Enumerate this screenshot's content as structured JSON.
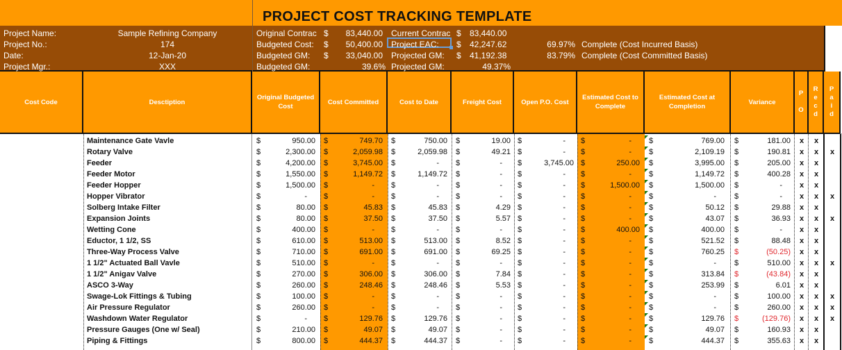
{
  "title": "PROJECT COST TRACKING TEMPLATE",
  "project_info": {
    "labels": [
      "Project Name:",
      "Project No.:",
      "Date:",
      "Project Mgr.:"
    ],
    "values": [
      "Sample Refining Company",
      "174",
      "12-Jan-20",
      "XXX"
    ]
  },
  "summary_left": [
    {
      "label": "Original Contrac",
      "currency": "$",
      "value": "83,440.00"
    },
    {
      "label": "Budgeted Cost:",
      "currency": "$",
      "value": "50,400.00"
    },
    {
      "label": "Budgeted GM:",
      "currency": "$",
      "value": "33,040.00"
    },
    {
      "label": "Budgeted GM:",
      "currency": "",
      "value": "39.6%"
    }
  ],
  "summary_right": [
    {
      "label": "Current Contrac",
      "currency": "$",
      "value": "83,440.00"
    },
    {
      "label": "Project EAC:",
      "currency": "$",
      "value": "42,247.62"
    },
    {
      "label": "Projected GM:",
      "currency": "$",
      "value": "41,192.38"
    },
    {
      "label": "Projected GM:",
      "currency": "",
      "value": "49.37%"
    }
  ],
  "completion": [
    {
      "percent": "69.97%",
      "label": "Complete (Cost Incurred Basis)"
    },
    {
      "percent": "83.79%",
      "label": "Complete (Cost Committed Basis)"
    }
  ],
  "selected_cell": "Project EAC:",
  "columns": {
    "cost_code": "Cost Code",
    "description": "Desctiption",
    "orig_budget": "Original  Budgeted Cost",
    "committed": "Cost Committed",
    "to_date": "Cost to Date",
    "freight": "Freight Cost",
    "open_po": "Open P.O. Cost",
    "est_complete": "Estimated Cost to Complete",
    "est_completion": "Estimated Cost at Completion",
    "variance": "Variance",
    "po": [
      "P",
      "",
      "O"
    ],
    "recd": [
      "R",
      "e",
      "c",
      "d"
    ],
    "paid": [
      "P",
      "a",
      "i",
      "d"
    ]
  },
  "currency_symbol": "$",
  "rows": [
    {
      "code": "",
      "desc": "Maintenance Gate Vavle",
      "orig": "950.00",
      "committed": "749.70",
      "to_date": "750.00",
      "freight": "19.00",
      "open_po": "-",
      "etc": "-",
      "eac": "769.00",
      "variance": "181.00",
      "variance_negative": false,
      "po": "x",
      "recd": "x",
      "paid": ""
    },
    {
      "code": "",
      "desc": "Rotary Valve",
      "orig": "2,300.00",
      "committed": "2,059.98",
      "to_date": "2,059.98",
      "freight": "49.21",
      "open_po": "-",
      "etc": "-",
      "eac": "2,109.19",
      "variance": "190.81",
      "variance_negative": false,
      "po": "x",
      "recd": "x",
      "paid": "x"
    },
    {
      "code": "",
      "desc": "Feeder",
      "orig": "4,200.00",
      "committed": "3,745.00",
      "to_date": "-",
      "freight": "-",
      "open_po": "3,745.00",
      "etc": "250.00",
      "eac": "3,995.00",
      "variance": "205.00",
      "variance_negative": false,
      "po": "x",
      "recd": "x",
      "paid": ""
    },
    {
      "code": "",
      "desc": "Feeder Motor",
      "orig": "1,550.00",
      "committed": "1,149.72",
      "to_date": "1,149.72",
      "freight": "-",
      "open_po": "-",
      "etc": "-",
      "eac": "1,149.72",
      "variance": "400.28",
      "variance_negative": false,
      "po": "x",
      "recd": "x",
      "paid": ""
    },
    {
      "code": "",
      "desc": "Feeder Hopper",
      "orig": "1,500.00",
      "committed": "-",
      "to_date": "-",
      "freight": "-",
      "open_po": "-",
      "etc": "1,500.00",
      "eac": "1,500.00",
      "variance": "-",
      "variance_negative": false,
      "po": "x",
      "recd": "x",
      "paid": ""
    },
    {
      "code": "",
      "desc": "Hopper Vibrator",
      "orig": "-",
      "committed": "-",
      "to_date": "-",
      "freight": "-",
      "open_po": "-",
      "etc": "-",
      "eac": "-",
      "variance": "-",
      "variance_negative": false,
      "po": "x",
      "recd": "x",
      "paid": "x"
    },
    {
      "code": "",
      "desc": "Solberg Intake Filter",
      "orig": "80.00",
      "committed": "45.83",
      "to_date": "45.83",
      "freight": "4.29",
      "open_po": "-",
      "etc": "-",
      "eac": "50.12",
      "variance": "29.88",
      "variance_negative": false,
      "po": "x",
      "recd": "x",
      "paid": ""
    },
    {
      "code": "",
      "desc": "Expansion Joints",
      "orig": "80.00",
      "committed": "37.50",
      "to_date": "37.50",
      "freight": "5.57",
      "open_po": "-",
      "etc": "-",
      "eac": "43.07",
      "variance": "36.93",
      "variance_negative": false,
      "po": "x",
      "recd": "x",
      "paid": "x"
    },
    {
      "code": "",
      "desc": "Wetting Cone",
      "orig": "400.00",
      "committed": "-",
      "to_date": "-",
      "freight": "-",
      "open_po": "-",
      "etc": "400.00",
      "eac": "400.00",
      "variance": "-",
      "variance_negative": false,
      "po": "x",
      "recd": "x",
      "paid": ""
    },
    {
      "code": "",
      "desc": "Eductor, 1 1/2, SS",
      "orig": "610.00",
      "committed": "513.00",
      "to_date": "513.00",
      "freight": "8.52",
      "open_po": "-",
      "etc": "-",
      "eac": "521.52",
      "variance": "88.48",
      "variance_negative": false,
      "po": "x",
      "recd": "x",
      "paid": ""
    },
    {
      "code": "",
      "desc": "Three-Way Process Valve",
      "orig": "710.00",
      "committed": "691.00",
      "to_date": "691.00",
      "freight": "69.25",
      "open_po": "-",
      "etc": "-",
      "eac": "760.25",
      "variance": "(50.25)",
      "variance_negative": true,
      "po": "x",
      "recd": "x",
      "paid": ""
    },
    {
      "code": "",
      "desc": "1 1/2\" Actuated Ball Vavle",
      "orig": "510.00",
      "committed": "-",
      "to_date": "-",
      "freight": "-",
      "open_po": "-",
      "etc": "-",
      "eac": "-",
      "variance": "510.00",
      "variance_negative": false,
      "po": "x",
      "recd": "x",
      "paid": "x"
    },
    {
      "code": "",
      "desc": "1 1/2\" Anigav Valve",
      "orig": "270.00",
      "committed": "306.00",
      "to_date": "306.00",
      "freight": "7.84",
      "open_po": "-",
      "etc": "-",
      "eac": "313.84",
      "variance": "(43.84)",
      "variance_negative": true,
      "po": "x",
      "recd": "x",
      "paid": ""
    },
    {
      "code": "",
      "desc": "ASCO 3-Way",
      "orig": "260.00",
      "committed": "248.46",
      "to_date": "248.46",
      "freight": "5.53",
      "open_po": "-",
      "etc": "-",
      "eac": "253.99",
      "variance": "6.01",
      "variance_negative": false,
      "po": "x",
      "recd": "x",
      "paid": ""
    },
    {
      "code": "",
      "desc": "Swage-Lok Fittings & Tubing",
      "orig": "100.00",
      "committed": "-",
      "to_date": "-",
      "freight": "-",
      "open_po": "-",
      "etc": "-",
      "eac": "-",
      "variance": "100.00",
      "variance_negative": false,
      "po": "x",
      "recd": "x",
      "paid": "x"
    },
    {
      "code": "",
      "desc": "Air Pressure Regulator",
      "orig": "260.00",
      "committed": "-",
      "to_date": "-",
      "freight": "-",
      "open_po": "-",
      "etc": "-",
      "eac": "-",
      "variance": "260.00",
      "variance_negative": false,
      "po": "x",
      "recd": "x",
      "paid": "x"
    },
    {
      "code": "",
      "desc": "Washdown Water Regulator",
      "orig": "-",
      "committed": "129.76",
      "to_date": "129.76",
      "freight": "-",
      "open_po": "-",
      "etc": "-",
      "eac": "129.76",
      "variance": "(129.76)",
      "variance_negative": true,
      "po": "x",
      "recd": "x",
      "paid": "x"
    },
    {
      "code": "",
      "desc": "Pressure Gauges (One w/ Seal)",
      "orig": "210.00",
      "committed": "49.07",
      "to_date": "49.07",
      "freight": "-",
      "open_po": "-",
      "etc": "-",
      "eac": "49.07",
      "variance": "160.93",
      "variance_negative": false,
      "po": "x",
      "recd": "x",
      "paid": ""
    },
    {
      "code": "",
      "desc": "Piping & Fittings",
      "orig": "800.00",
      "committed": "444.37",
      "to_date": "444.37",
      "freight": "-",
      "open_po": "-",
      "etc": "-",
      "eac": "444.37",
      "variance": "355.63",
      "variance_negative": false,
      "po": "x",
      "recd": "x",
      "paid": ""
    }
  ],
  "colors": {
    "accent_orange": "#ff9900",
    "info_brown": "#974c06",
    "negative_red": "#e0282e",
    "selection_blue": "#6a9fd8",
    "comment_flag_green": "#1a7a1a"
  }
}
